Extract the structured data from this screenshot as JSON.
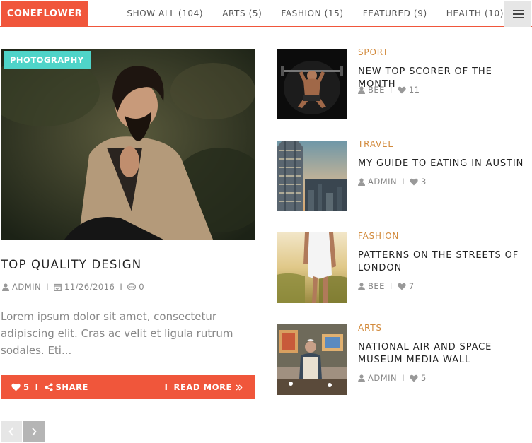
{
  "brand": "CONEFLOWER",
  "filters": [
    "SHOW ALL (104)",
    "ARTS (5)",
    "FASHION (15)",
    "FEATURED (9)",
    "HEALTH (10)"
  ],
  "featured": {
    "category": "PHOTOGRAPHY",
    "title": "TOP QUALITY DESIGN",
    "author": "ADMIN",
    "date": "11/26/2016",
    "comments": "0",
    "excerpt": "Lorem ipsum dolor sit amet, consectetur adipiscing elit. Cras ac velit et ligula rutrum sodales. Eti...",
    "likes": "5",
    "share_label": "SHARE",
    "read_more_label": "READ MORE"
  },
  "posts": [
    {
      "category": "SPORT",
      "title": "NEW TOP SCORER OF THE MONTH",
      "author": "BEE",
      "likes": "11"
    },
    {
      "category": "TRAVEL",
      "title": "MY GUIDE TO EATING IN AUSTIN",
      "author": "ADMIN",
      "likes": "3"
    },
    {
      "category": "FASHION",
      "title": "PATTERNS ON THE STREETS OF LONDON",
      "author": "BEE",
      "likes": "7"
    },
    {
      "category": "ARTS",
      "title": "NATIONAL AIR AND SPACE MUSEUM MEDIA WALL",
      "author": "ADMIN",
      "likes": "5"
    }
  ],
  "colors": {
    "accent": "#f0563b",
    "badge": "#4fd4c9",
    "category": "#d28a3c",
    "meta": "#888888"
  }
}
